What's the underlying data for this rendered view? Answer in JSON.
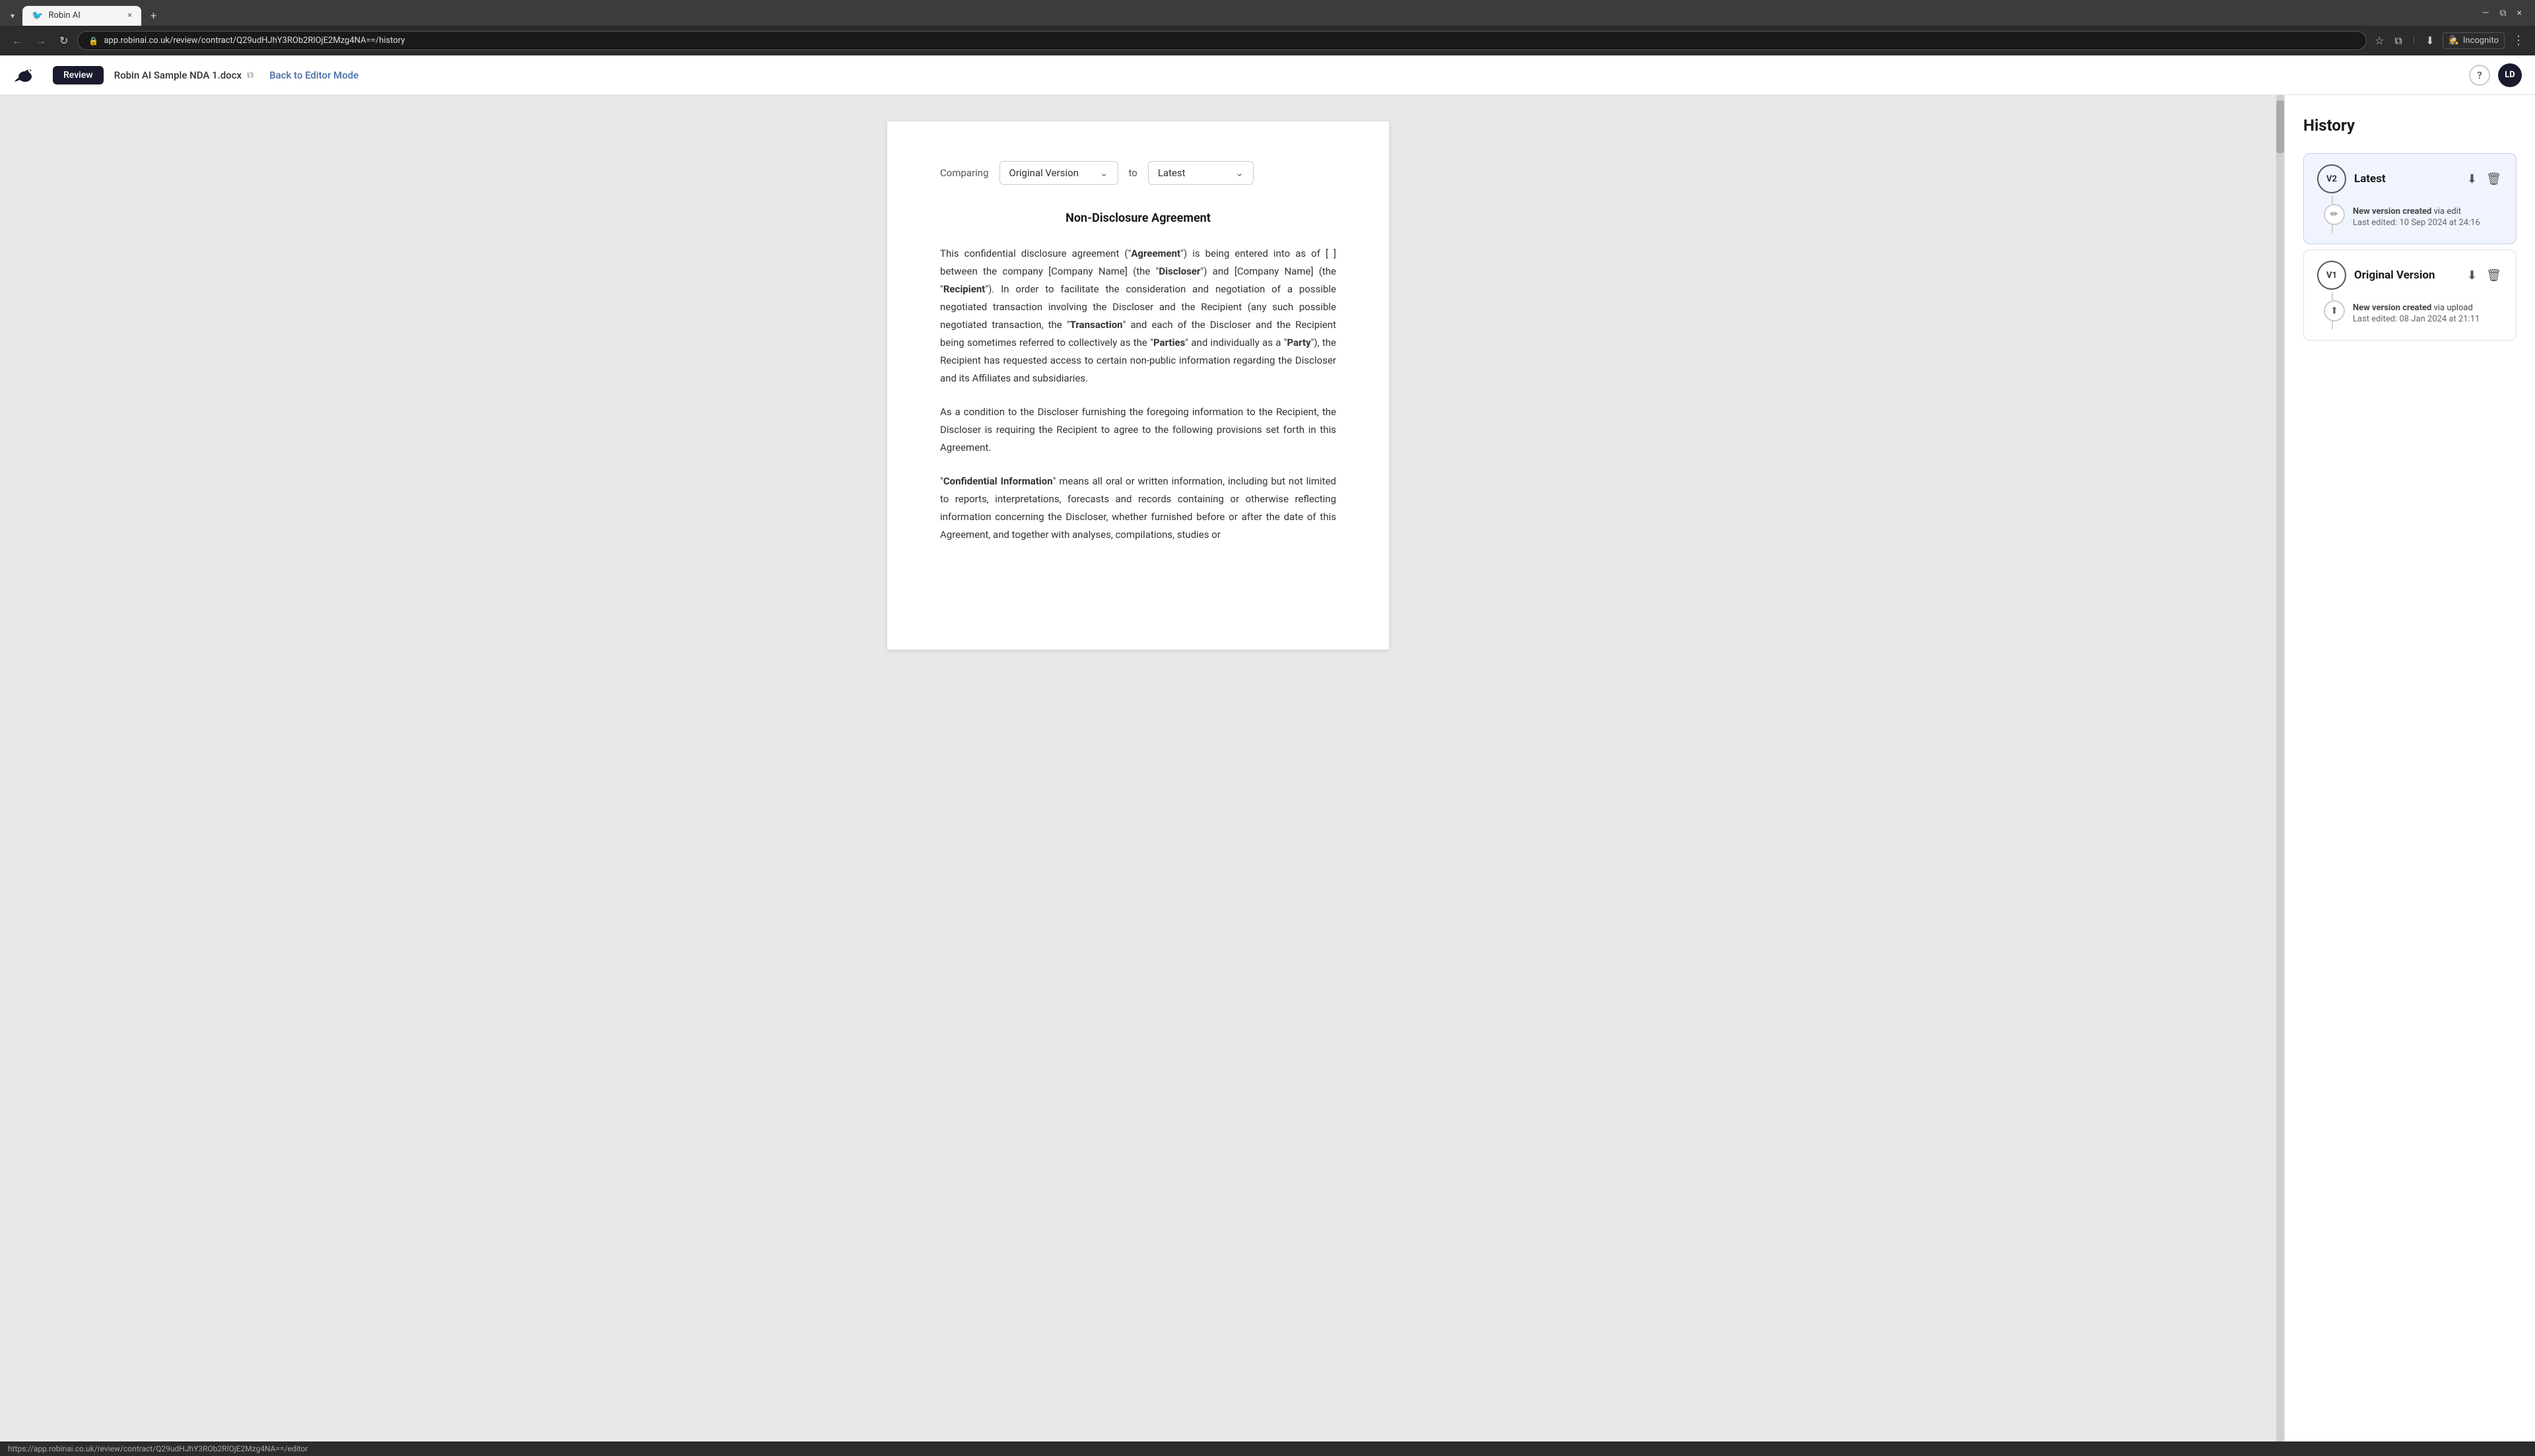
{
  "browser": {
    "tab_label": "Robin AI",
    "url": "app.robinai.co.uk/review/contract/Q29udHJhY3ROb2RlOjE2Mzg4NA==/history",
    "nav_back": "←",
    "nav_forward": "→",
    "nav_refresh": "↻",
    "tab_close": "×",
    "tab_new": "+",
    "incognito_label": "Incognito",
    "window_minimize": "—",
    "window_maximize": "⧉",
    "window_close": "×",
    "status_url": "https://app.robinai.co.uk/review/contract/Q29udHJhY3ROb2RlOjE2Mzg4NA==/editor"
  },
  "header": {
    "review_label": "Review",
    "doc_title": "Robin AI Sample NDA 1.docx",
    "back_to_editor": "Back to Editor Mode",
    "help_icon": "?",
    "avatar_label": "LD"
  },
  "comparing": {
    "label": "Comparing",
    "from_version": "Original Version",
    "to_label": "to",
    "to_version": "Latest"
  },
  "document": {
    "title": "Non-Disclosure Agreement",
    "paragraph1": "This confidential disclosure agreement (",
    "agreement_bold": "Agreement",
    "paragraph1_rest": ") is being entered into as of [  ] between the company [Company Name] (the “",
    "discloser_bold": "Discloser",
    "paragraph1_rest2": "”) and [Company Name] (the “",
    "recipient_bold": "Recipient",
    "paragraph1_rest3": "”). In order to facilitate the consideration and negotiation of a possible negotiated transaction involving the Discloser and the Recipient (any such possible negotiated transaction, the “",
    "transaction_bold": "Transaction",
    "paragraph1_rest4": "” and each of the Discloser and the Recipient being sometimes referred to collectively as the “",
    "parties_bold": "Parties",
    "paragraph1_rest5": "” and individually as a “",
    "party_bold": "Party",
    "paragraph1_rest6": "”), the Recipient has requested access to certain non-public information regarding the Discloser and its Affiliates and subsidiaries.",
    "paragraph2": "As a condition to the Discloser furnishing the foregoing information to the Recipient, the Discloser is requiring the Recipient to agree to the following provisions set forth in this Agreement.",
    "paragraph3_start": "“",
    "confidential_bold": "Confidential Information",
    "paragraph3_rest": "” means all oral or written information, including but not limited to reports, interpretations, forecasts and records containing or otherwise reflecting information concerning the Discloser, whether furnished before or after the date of this Agreement, and together with analyses, compilations, studies or"
  },
  "history": {
    "title": "History",
    "versions": [
      {
        "id": "v2",
        "badge": "V2",
        "name": "Latest",
        "active": true,
        "timeline_event": "New version created",
        "timeline_method": "via edit",
        "timeline_date": "Last edited: 10 Sep 2024 at 24:16",
        "icon_type": "edit"
      },
      {
        "id": "v1",
        "badge": "V1",
        "name": "Original Version",
        "active": false,
        "timeline_event": "New version created",
        "timeline_method": "via upload",
        "timeline_date": "Last edited: 08 Jan 2024 at 21:11",
        "icon_type": "upload"
      }
    ]
  },
  "icons": {
    "download": "⬇",
    "delete": "🗑",
    "edit": "✏",
    "upload": "⬆",
    "copy": "⧉",
    "chevron_down": "⌄",
    "lock": "🔒",
    "star": "☆",
    "downloads": "⬇",
    "menu": "⋮",
    "settings": "⚙",
    "chat_bubble": "💬",
    "back": "←",
    "forward": "→"
  }
}
